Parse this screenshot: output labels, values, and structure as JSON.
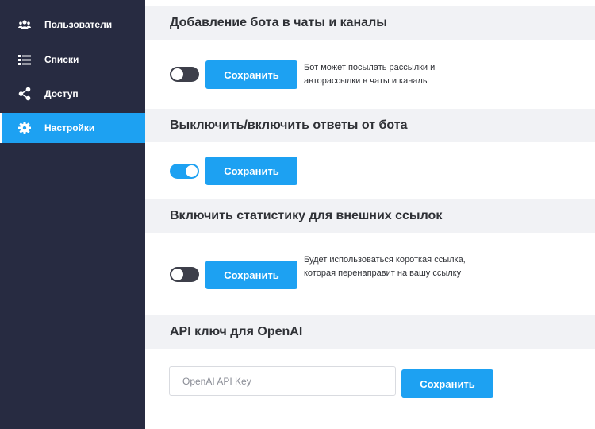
{
  "sidebar": {
    "items": [
      {
        "label": "Пользователи",
        "icon": "users-icon",
        "active": false
      },
      {
        "label": "Списки",
        "icon": "list-icon",
        "active": false
      },
      {
        "label": "Доступ",
        "icon": "share-icon",
        "active": false
      },
      {
        "label": "Настройки",
        "icon": "gear-icon",
        "active": true
      }
    ]
  },
  "sections": {
    "bot_chats": {
      "title": "Добавление бота в чаты и каналы",
      "toggle_on": false,
      "save_label": "Сохранить",
      "description": "Бот может посылать рассылки и авторассылки в чаты и каналы"
    },
    "bot_replies": {
      "title": "Выключить/включить ответы от бота",
      "toggle_on": true,
      "save_label": "Сохранить"
    },
    "link_stats": {
      "title": "Включить статистику для внешних ссылок",
      "toggle_on": false,
      "save_label": "Сохранить",
      "description": "Будет использоваться короткая ссылка, которая перенаправит на вашу ссылку"
    },
    "openai": {
      "title": "API ключ для OpenAI",
      "input_value": "",
      "input_placeholder": "OpenAI API Key",
      "save_label": "Сохранить"
    }
  },
  "colors": {
    "sidebar_bg": "#272b41",
    "accent": "#1da1f2",
    "header_bg": "#f1f2f5",
    "toggle_off": "#3d3f4a"
  }
}
